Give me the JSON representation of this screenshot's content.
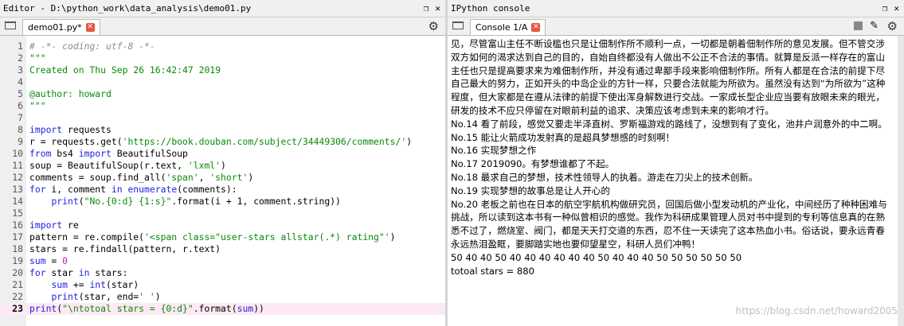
{
  "editor": {
    "title": "Editor - D:\\python_work\\data_analysis\\demo01.py",
    "tab_label": "demo01.py*",
    "current_line": 23,
    "lines": [
      [
        [
          "cm",
          "# -*- coding: utf-8 -*-"
        ]
      ],
      [
        [
          "str",
          "\"\"\""
        ]
      ],
      [
        [
          "str",
          "Created on Thu Sep 26 16:42:47 2019"
        ]
      ],
      [],
      [
        [
          "str",
          "@author: howard"
        ]
      ],
      [
        [
          "str",
          "\"\"\""
        ]
      ],
      [],
      [
        [
          "kw",
          "import"
        ],
        [
          "t",
          " requests"
        ]
      ],
      [
        [
          "t",
          "r = requests.get("
        ],
        [
          "str",
          "'https://book.douban.com/subject/34449306/comments/'"
        ],
        [
          "t",
          ")"
        ]
      ],
      [
        [
          "kw",
          "from"
        ],
        [
          "t",
          " bs4 "
        ],
        [
          "kw",
          "import"
        ],
        [
          "t",
          " BeautifulSoup"
        ]
      ],
      [
        [
          "t",
          "soup = BeautifulSoup(r.text, "
        ],
        [
          "str",
          "'lxml'"
        ],
        [
          "t",
          ")"
        ]
      ],
      [
        [
          "t",
          "comments = soup.find_all("
        ],
        [
          "str",
          "'span'"
        ],
        [
          "t",
          ", "
        ],
        [
          "str",
          "'short'"
        ],
        [
          "t",
          ")"
        ]
      ],
      [
        [
          "kw",
          "for"
        ],
        [
          "t",
          " i, comment "
        ],
        [
          "kw",
          "in"
        ],
        [
          "t",
          " "
        ],
        [
          "kw",
          "enumerate"
        ],
        [
          "t",
          "(comments):"
        ]
      ],
      [
        [
          "t",
          "    "
        ],
        [
          "kw",
          "print"
        ],
        [
          "t",
          "("
        ],
        [
          "str",
          "\"No.{0:d} {1:s}\""
        ],
        [
          "t",
          ".format(i + 1, comment.string))"
        ]
      ],
      [],
      [
        [
          "kw",
          "import"
        ],
        [
          "t",
          " re"
        ]
      ],
      [
        [
          "t",
          "pattern = re.compile("
        ],
        [
          "str",
          "'<span class=\"user-stars allstar(.*) rating\"'"
        ],
        [
          "t",
          ")"
        ]
      ],
      [
        [
          "t",
          "stars = re.findall(pattern, r.text)"
        ]
      ],
      [
        [
          "kw",
          "sum"
        ],
        [
          "t",
          " = "
        ],
        [
          "num",
          "0"
        ]
      ],
      [
        [
          "kw",
          "for"
        ],
        [
          "t",
          " star "
        ],
        [
          "kw",
          "in"
        ],
        [
          "t",
          " stars:"
        ]
      ],
      [
        [
          "t",
          "    "
        ],
        [
          "kw",
          "sum"
        ],
        [
          "t",
          " += "
        ],
        [
          "kw",
          "int"
        ],
        [
          "t",
          "(star)"
        ]
      ],
      [
        [
          "t",
          "    "
        ],
        [
          "kw",
          "print"
        ],
        [
          "t",
          "(star, end="
        ],
        [
          "str",
          "' '"
        ],
        [
          "t",
          ")"
        ]
      ],
      [
        [
          "kw",
          "print"
        ],
        [
          "t",
          "("
        ],
        [
          "str",
          "\"\\ntotoal stars = {0:d}\""
        ],
        [
          "t",
          ".format("
        ],
        [
          "kw",
          "sum"
        ],
        [
          "t",
          "))"
        ]
      ]
    ]
  },
  "console": {
    "title": "IPython console",
    "tab_label": "Console 1/A",
    "output": "见，尽管富山主任不断设槛也只是让佃制作所不顺利一点，一切都是朝着佃制作所的意见发展。但不管交涉双方如何的渴求达到自己的目的，自始自终都没有人做出不公正不合法的事情。就算是反派一样存在的富山主任也只是提高要求来为难佃制作所，并没有通过卑鄙手段来影响佃制作所。所有人都是在合法的前提下尽自己最大的努力，正如开头的中岛企业的方针一样，只要合法就能为所欲为。虽然没有达到“为所欲为”这种程度，但大家都是在遵从法律的前提下使出浑身解数进行交战。一家成长型企业应当要有放眼未来的眼光，研发的技术不应只停留在对眼前利益的追求、决策应该考虑到未来的影响才行。\nNo.14 看了前段，感觉又要走半泽直树、罗斯福游戏的路线了，没想到有了变化，池井户润意外的中二啊。\nNo.15 能让火箭成功发射真的是超具梦想感的时刻啊！\nNo.16 实现梦想之作\nNo.17 2019090。有梦想谁都了不起。\nNo.18 最求自己的梦想，技术性领导人的执着。游走在刀尖上的技术创新。\nNo.19 实现梦想的故事总是让人开心的\nNo.20 老板之前也在日本的航空宇航机构做研究员，回国后做小型发动机的产业化，中间经历了种种困难与挑战，所以读到这本书有一种似曾相识的感觉。我作为科研成果管理人员对书中提到的专利等信息真的在熟悉不过了，燃烧室、阀门，都是天天打交道的东西，忍不住一天读完了这本热血小书。俗话说，要永远青春永远热泪盈眶，要脚踏实地也要仰望星空，科研人员们冲鸭！\n50 40 40 50 40 40 40 40 40 40 50 40 40 40 50 50 50 50 50 50\ntotoal stars = 880"
  },
  "watermark": "https://blog.csdn.net/howard2005"
}
